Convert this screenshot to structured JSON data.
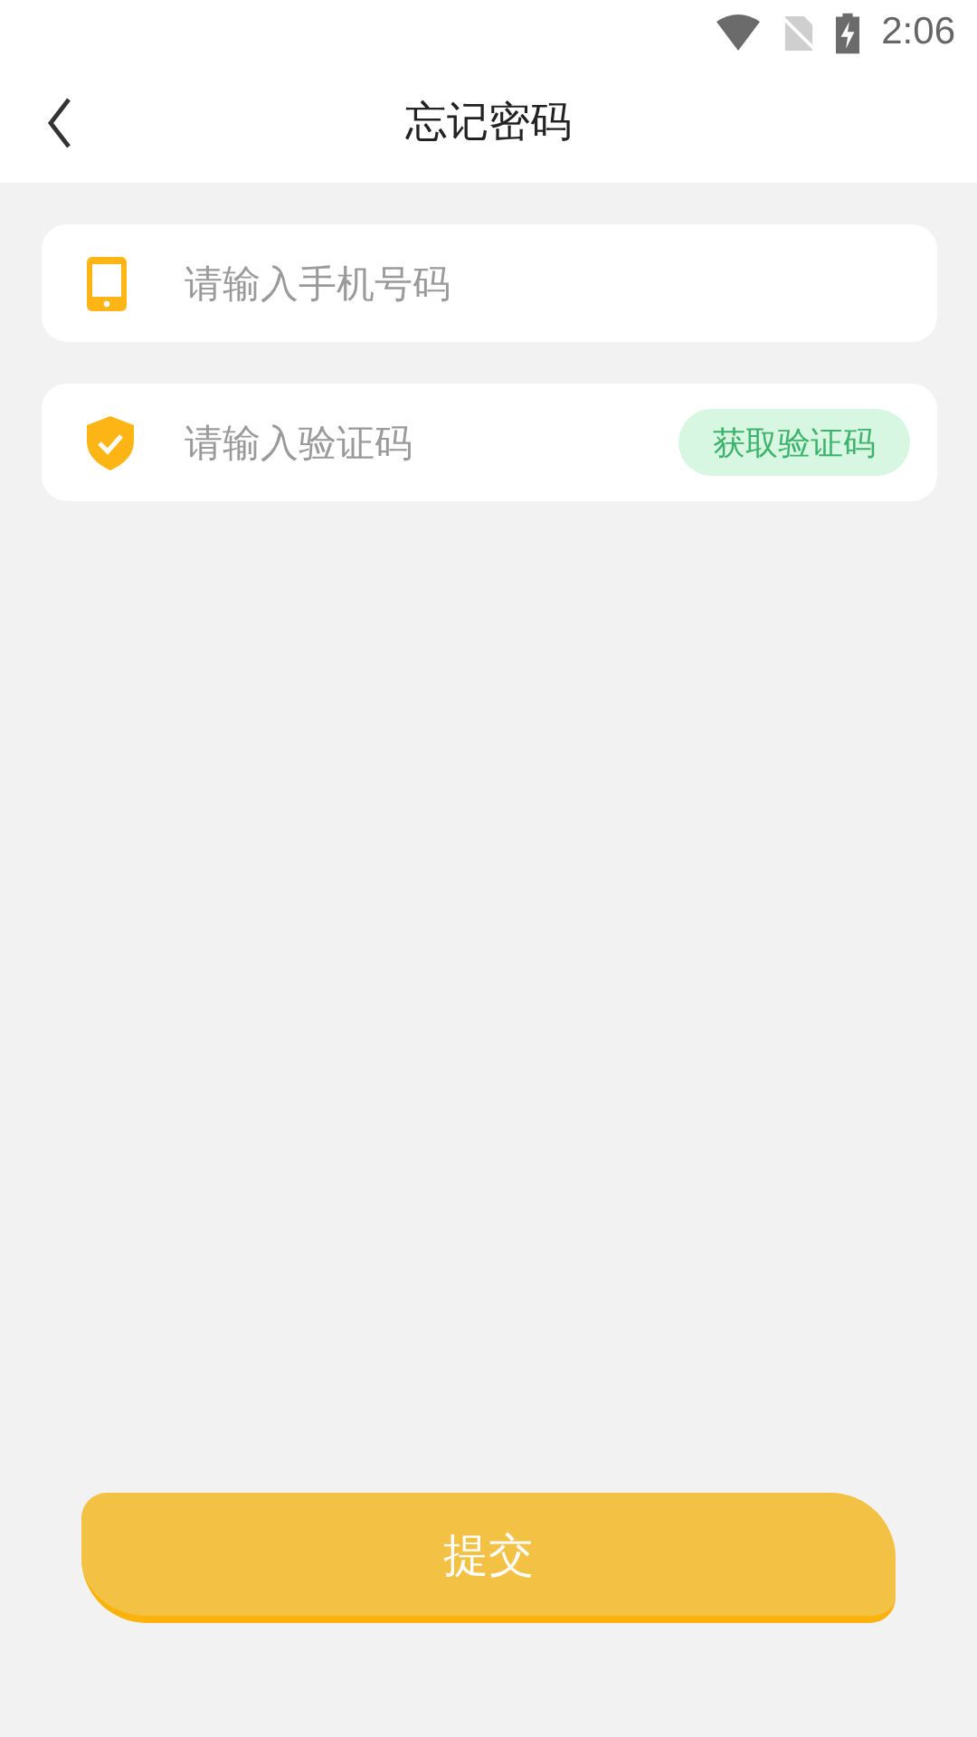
{
  "status_bar": {
    "time": "2:06"
  },
  "header": {
    "title": "忘记密码"
  },
  "fields": [
    {
      "kind": "phone",
      "placeholder": "请输入手机号码"
    },
    {
      "kind": "code",
      "placeholder": "请输入验证码",
      "action": "获取验证码"
    }
  ],
  "submit_button": {
    "label": "提交"
  }
}
